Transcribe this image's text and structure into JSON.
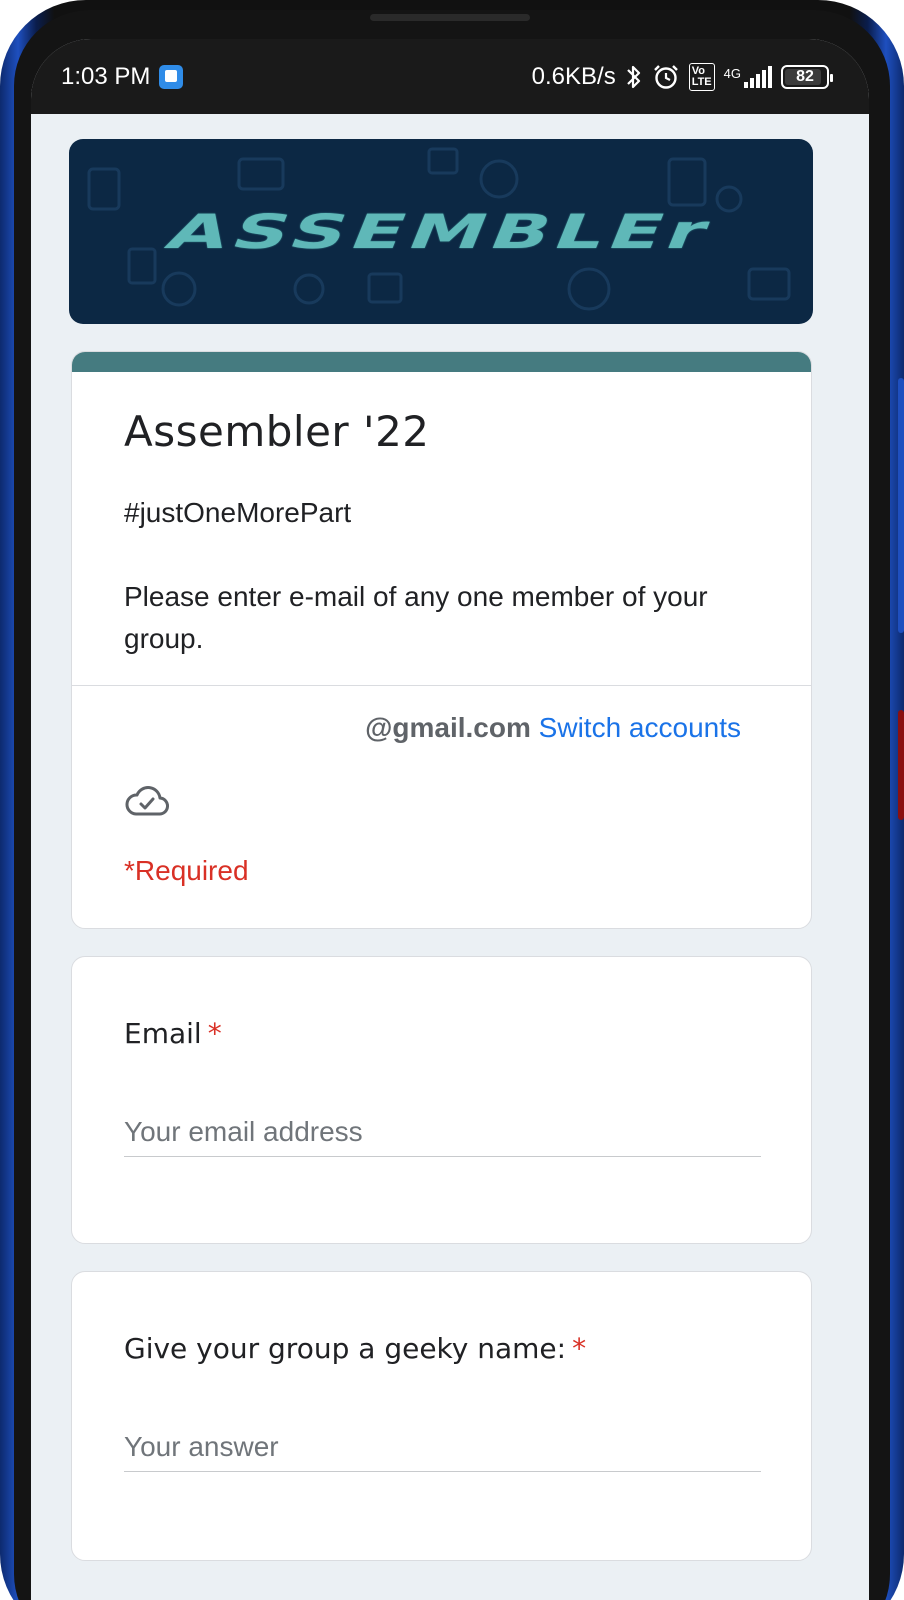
{
  "status_bar": {
    "time": "1:03 PM",
    "net_speed": "0.6KB/s",
    "volte": "Vo\nLTE",
    "network": "4G",
    "battery": "82"
  },
  "banner": {
    "title": "ASSEMBLEr"
  },
  "form": {
    "title": "Assembler '22",
    "description_line1": "#justOneMorePart",
    "description_line2": "Please enter e-mail of any one member of your group.",
    "account_email": "@gmail.com",
    "switch_accounts": "Switch accounts",
    "required_note": "*Required"
  },
  "questions": [
    {
      "label": "Email",
      "required_mark": "*",
      "placeholder": "Your email address"
    },
    {
      "label": "Give your group a geeky name:",
      "required_mark": "*",
      "placeholder": "Your answer"
    }
  ],
  "colors": {
    "accent": "#457b80",
    "link": "#1a73e8",
    "required": "#d93025",
    "banner_bg": "#0c2844"
  },
  "icons": [
    "app-notification-icon",
    "bluetooth-icon",
    "alarm-icon",
    "signal-icon",
    "battery-icon",
    "cloud-check-icon"
  ]
}
